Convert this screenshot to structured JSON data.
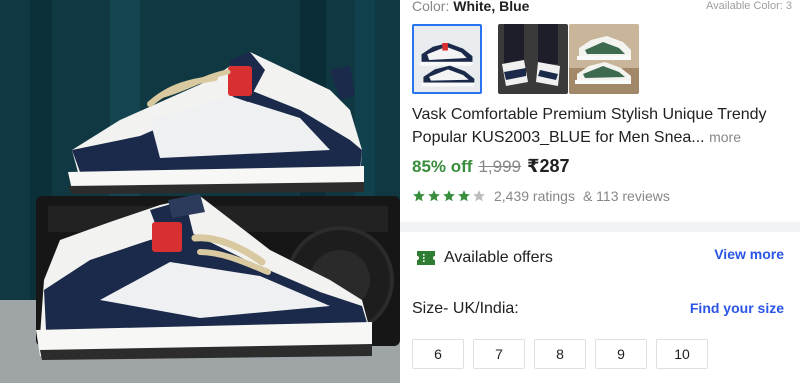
{
  "product": {
    "color_label": "Color: ",
    "color_value": "White, Blue",
    "available_colors": "Available Color: 3",
    "thumbnails": [
      {
        "name": "thumbnail-white-blue-sneaker",
        "selected": true
      },
      {
        "name": "thumbnail-worn-sneaker",
        "selected": false
      },
      {
        "name": "thumbnail-green-sneaker",
        "selected": false
      }
    ],
    "title": "Vask Comfortable Premium Stylish Unique Trendy Popular KUS2003_BLUE for Men Snea...",
    "more_label": "more",
    "discount": "85% off",
    "mrp": "1,999",
    "price": "₹287",
    "rating_stars": 4,
    "ratings_text": "2,439 ratings",
    "reviews_text": "& 113 reviews",
    "colors": {
      "star": "#388e3c",
      "offer": "#2e7d32",
      "link": "#2a55e5",
      "discount": "#388e3c"
    }
  },
  "offers": {
    "icon": "offer-tag-icon",
    "label": "Available offers",
    "view_more": "View more"
  },
  "size": {
    "label": "Size- UK/India:",
    "find_label": "Find your size",
    "options": [
      "6",
      "7",
      "8",
      "9",
      "10"
    ]
  }
}
